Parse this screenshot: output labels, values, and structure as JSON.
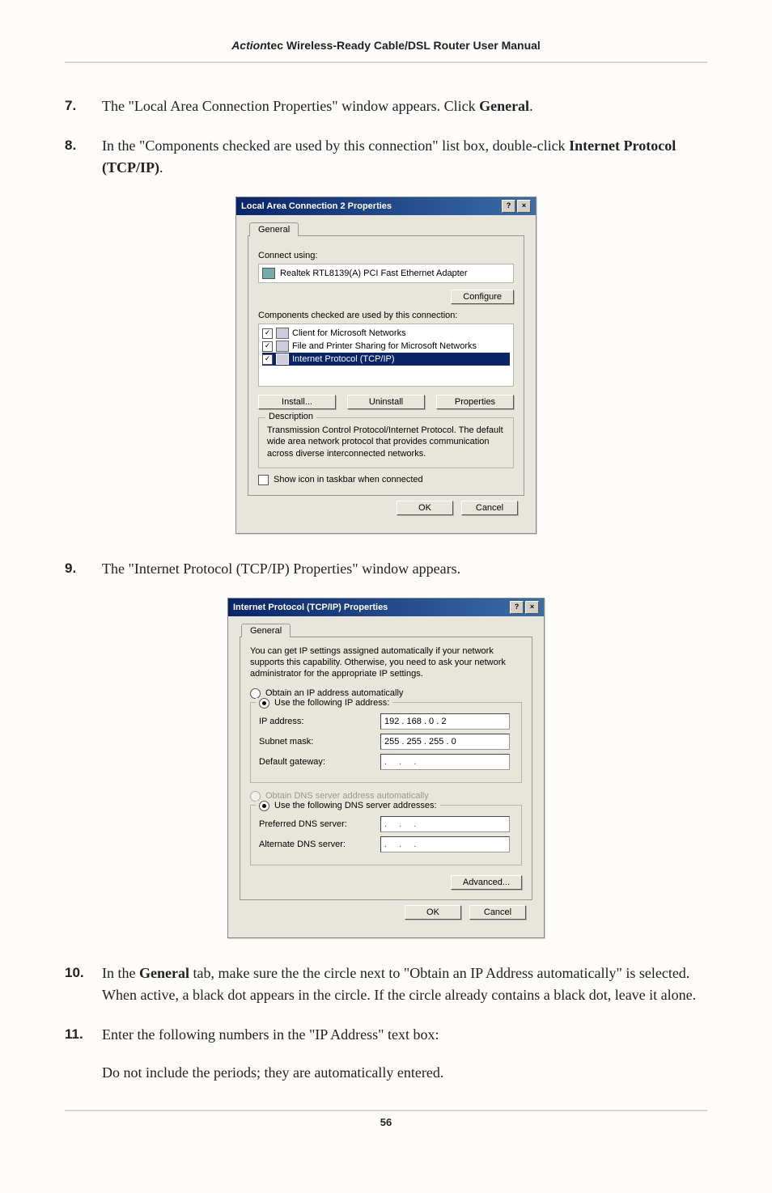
{
  "header": {
    "brand": "Action",
    "brand_suffix": "tec",
    "title_rest": " Wireless-Ready Cable/DSL Router User Manual"
  },
  "steps": {
    "s7": {
      "num": "7.",
      "text_a": "The \"Local Area Connection Properties\" window appears. Click ",
      "bold": "General",
      "text_b": "."
    },
    "s8": {
      "num": "8.",
      "text_a": "In the \"Components checked are used by this connection\" list box, double-click ",
      "bold": "Internet Protocol (TCP/IP)",
      "text_b": "."
    },
    "s9": {
      "num": "9.",
      "text_a": "The \"Internet Protocol (TCP/IP) Properties\" window appears."
    },
    "s10": {
      "num": "10.",
      "text_a": "In the ",
      "bold": "General",
      "text_b": " tab, make sure the the circle next to \"Obtain an IP Address automatically\" is selected. When active, a black dot appears in the circle.  If the circle already contains a black dot, leave it alone."
    },
    "s11": {
      "num": "11.",
      "text_a": "Enter the following numbers in the \"IP Address\" text box:",
      "text_b": "Do not include the periods; they are automatically entered."
    }
  },
  "dlg1": {
    "title": "Local Area Connection 2 Properties",
    "tab": "General",
    "connect_using": "Connect using:",
    "adapter": "Realtek RTL8139(A) PCI Fast Ethernet Adapter",
    "configure": "Configure",
    "components_label": "Components checked are used by this connection:",
    "comp1": "Client for Microsoft Networks",
    "comp2": "File and Printer Sharing for Microsoft Networks",
    "comp3": "Internet Protocol (TCP/IP)",
    "install": "Install...",
    "uninstall": "Uninstall",
    "properties": "Properties",
    "desc_title": "Description",
    "desc_text": "Transmission Control Protocol/Internet Protocol. The default wide area network protocol that provides communication across diverse interconnected networks.",
    "show_icon": "Show icon in taskbar when connected",
    "ok": "OK",
    "cancel": "Cancel",
    "help": "?",
    "close": "×"
  },
  "dlg2": {
    "title": "Internet Protocol (TCP/IP) Properties",
    "tab": "General",
    "intro": "You can get IP settings assigned automatically if your network supports this capability. Otherwise, you need to ask your network administrator for the appropriate IP settings.",
    "opt_auto": "Obtain an IP address automatically",
    "opt_manual": "Use the following IP address:",
    "ip_label": "IP address:",
    "ip_value": "192 . 168 .   0   .   2",
    "subnet_label": "Subnet mask:",
    "subnet_value": "255 . 255 . 255 .   0",
    "gateway_label": "Default gateway:",
    "gateway_value": ".        .        .",
    "dns_auto": "Obtain DNS server address automatically",
    "dns_manual": "Use the following DNS server addresses:",
    "pref_dns": "Preferred DNS server:",
    "alt_dns": "Alternate DNS server:",
    "dns_empty": ".        .        .",
    "advanced": "Advanced...",
    "ok": "OK",
    "cancel": "Cancel",
    "help": "?",
    "close": "×"
  },
  "footer": {
    "page": "56"
  }
}
